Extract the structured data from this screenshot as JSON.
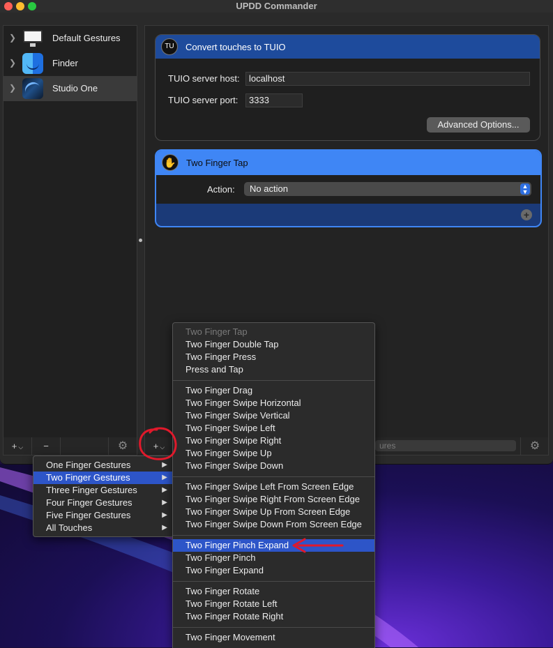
{
  "window": {
    "title": "UPDD Commander"
  },
  "sidebar": {
    "apps": [
      {
        "label": "Default Gestures",
        "icon": "monitor-icon"
      },
      {
        "label": "Finder",
        "icon": "finder-icon"
      },
      {
        "label": "Studio One",
        "icon": "studio-one-icon"
      }
    ],
    "toolbar": {
      "add": "+",
      "add_chevron": "⌵",
      "remove": "−",
      "gear": "⚙"
    }
  },
  "tuio_card": {
    "title": "Convert touches to TUIO",
    "icon": "tuio-icon",
    "host_label": "TUIO server host:",
    "host_value": "localhost",
    "port_label": "TUIO server port:",
    "port_value": "3333",
    "advanced_button": "Advanced Options..."
  },
  "gesture_card": {
    "title": "Two Finger Tap",
    "icon": "hand-icon",
    "action_label": "Action:",
    "action_value": "No action",
    "add_button": "+"
  },
  "main_toolbar": {
    "add": "+",
    "add_chevron": "⌵",
    "filter_placeholder": "ures",
    "gear": "⚙"
  },
  "category_menu": {
    "items": [
      {
        "label": "One Finger Gestures"
      },
      {
        "label": "Two Finger Gestures",
        "highlighted": true
      },
      {
        "label": "Three Finger Gestures"
      },
      {
        "label": "Four Finger Gestures"
      },
      {
        "label": "Five Finger Gestures"
      },
      {
        "label": "All Touches"
      }
    ],
    "arrow": "▶"
  },
  "gesture_menu": {
    "groups": [
      [
        "Two Finger Tap",
        "Two Finger Double Tap",
        "Two Finger Press",
        "Press and Tap"
      ],
      [
        "Two Finger Drag",
        "Two Finger Swipe Horizontal",
        "Two Finger Swipe Vertical",
        "Two Finger Swipe Left",
        "Two Finger Swipe Right",
        "Two Finger Swipe Up",
        "Two Finger Swipe Down"
      ],
      [
        "Two Finger Swipe Left From Screen Edge",
        "Two Finger Swipe Right From Screen Edge",
        "Two Finger Swipe Up From Screen Edge",
        "Two Finger Swipe Down From Screen Edge"
      ],
      [
        "Two Finger Pinch Expand",
        "Two Finger Pinch",
        "Two Finger Expand"
      ],
      [
        "Two Finger Rotate",
        "Two Finger Rotate Left",
        "Two Finger Rotate Right"
      ],
      [
        "Two Finger Movement"
      ]
    ],
    "disabled": "Two Finger Tap",
    "highlighted": "Two Finger Pinch Expand"
  },
  "colors": {
    "accent_blue": "#2d55c8",
    "card_header_dark_blue": "#1e4b9c",
    "card_header_light_blue": "#3f86f5",
    "annotation_red": "#e0192b"
  }
}
